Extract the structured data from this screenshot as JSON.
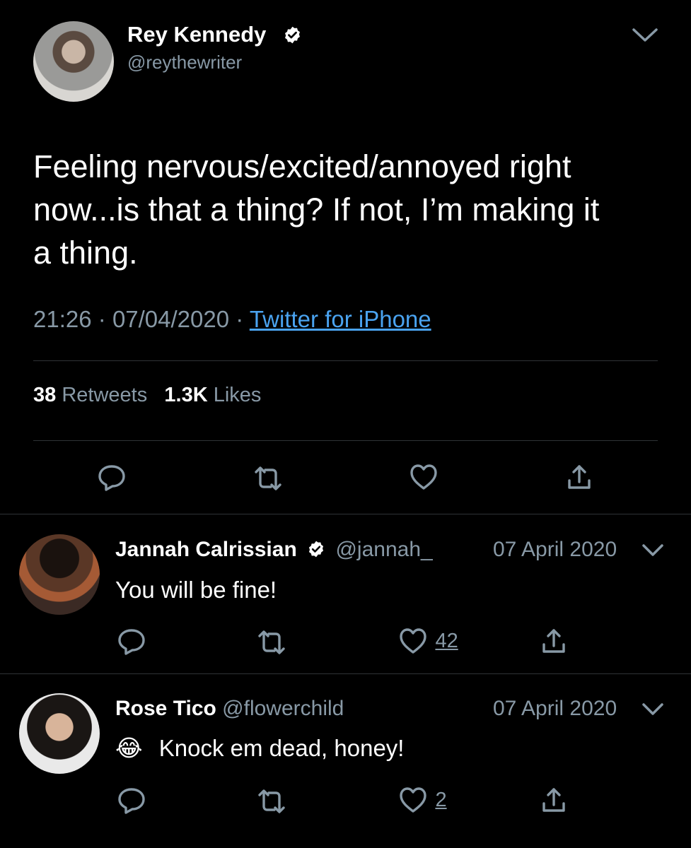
{
  "main_tweet": {
    "author_name": "Rey Kennedy",
    "author_handle": "@reythewriter",
    "text_lines": [
      "Feeling nervous/excited/annoyed right",
      "now...is that a thing? If not, I’m making it",
      "a thing."
    ],
    "time": "21:26",
    "date": "07/04/2020",
    "source": "Twitter for iPhone",
    "retweets_count": "38",
    "retweets_label": "Retweets",
    "likes_count": "1.3K",
    "likes_label": "Likes"
  },
  "replies": [
    {
      "author_name": "Jannah Calrissian",
      "author_handle": "@jannah_",
      "date": "07 April 2020",
      "text": "You will be fine!",
      "like_count": "42"
    },
    {
      "author_name": "Rose Tico",
      "author_handle": "@flowerchild",
      "date": "07 April 2020",
      "emoji": "😂",
      "text": "Knock em dead, honey!",
      "like_count": "2"
    }
  ],
  "colors": {
    "background": "#000000",
    "secondary_text": "#8899a6",
    "link": "#4aa3f0",
    "divider": "#2f3336"
  }
}
